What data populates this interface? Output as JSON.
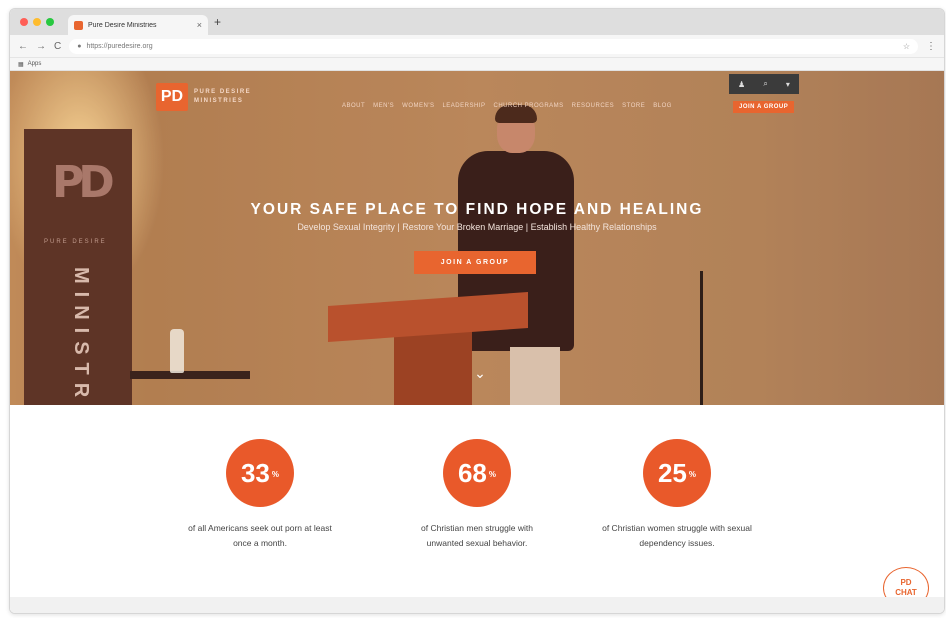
{
  "browser": {
    "tab_title": "Pure Desire Ministries",
    "tab_close": "×",
    "new_tab": "+",
    "nav_back": "←",
    "nav_forward": "→",
    "nav_reload": "C",
    "url": "https://puredesire.org",
    "bookmark_label": "Apps"
  },
  "site": {
    "logo_mark": "PD",
    "logo_line1": "PURE DESIRE",
    "logo_line2": "MINISTRIES",
    "nav_items": [
      "ABOUT",
      "MEN'S",
      "WOMEN'S",
      "LEADERSHIP",
      "CHURCH PROGRAMS",
      "RESOURCES",
      "STORE",
      "BLOG"
    ],
    "nav_cta": "JOIN A GROUP",
    "banner_text": "PURE DESIRE",
    "banner_vertical": "MINISTRIES",
    "banner_mark": "PD"
  },
  "hero": {
    "headline": "YOUR SAFE PLACE TO FIND HOPE AND HEALING",
    "subline": "Develop Sexual Integrity | Restore Your Broken Marriage | Establish Healthy Relationships",
    "cta": "JOIN A GROUP"
  },
  "stats": [
    {
      "value": "33",
      "unit": "%",
      "desc1": "of all Americans seek out porn at least",
      "desc2": "once a month."
    },
    {
      "value": "68",
      "unit": "%",
      "desc1": "of Christian men struggle with",
      "desc2": "unwanted sexual behavior."
    },
    {
      "value": "25",
      "unit": "%",
      "desc1": "of Christian women struggle with sexual",
      "desc2": "dependency issues."
    }
  ],
  "chat": {
    "line1": "PD",
    "line2": "CHAT"
  },
  "colors": {
    "accent": "#e8652f",
    "stat_circle": "#e9592a"
  }
}
